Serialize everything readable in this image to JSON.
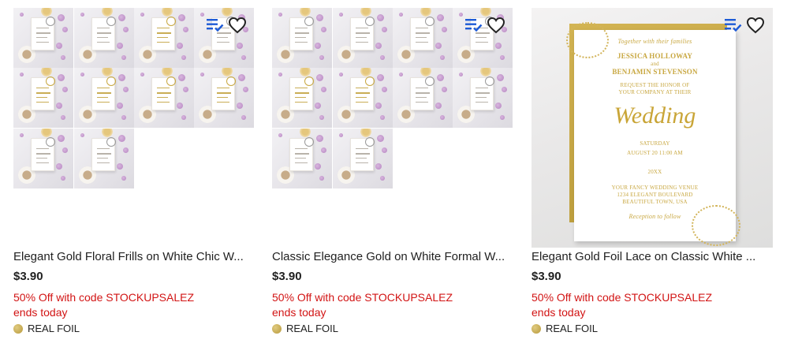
{
  "products": [
    {
      "title": "Elegant Gold Floral Frills on White Chic W...",
      "price": "$3.90",
      "promo_line1": "50% Off with code STOCKUPSALEZ",
      "promo_line2": "ends today",
      "badge": "REAL FOIL",
      "thumbnail_count": 10,
      "icons": [
        "add-to-list-icon",
        "heart-icon"
      ]
    },
    {
      "title": "Classic Elegance Gold on White Formal W...",
      "price": "$3.90",
      "promo_line1": "50% Off with code STOCKUPSALEZ",
      "promo_line2": "ends today",
      "badge": "REAL FOIL",
      "thumbnail_count": 10,
      "icons": [
        "add-to-list-icon",
        "heart-icon"
      ]
    },
    {
      "title": "Elegant Gold Foil Lace on Classic White ...",
      "price": "$3.90",
      "promo_line1": "50% Off with code STOCKUPSALEZ",
      "promo_line2": "ends today",
      "badge": "REAL FOIL",
      "icons": [
        "add-to-list-icon",
        "heart-icon"
      ],
      "invitation": {
        "top_script": "Together with their families",
        "name1": "JESSICA HOLLOWAY",
        "and": "and",
        "name2": "BENJAMIN STEVENSON",
        "request1": "REQUEST THE HONOR OF",
        "request2": "YOUR COMPANY AT THEIR",
        "script": "Wedding",
        "weekday": "SATURDAY",
        "date_line": "AUGUST  20  11:00 AM",
        "day": "20",
        "year": "20XX",
        "venue1": "YOUR FANCY WEDDING VENUE",
        "venue2": "1234 ELEGANT BOULEVARD",
        "venue3": "BEAUTIFUL TOWN, USA",
        "reception": "Reception to follow"
      }
    }
  ],
  "colors": {
    "promo_red": "#d21414",
    "list_icon_blue": "#1e5bd6",
    "gold": "#c8a740"
  }
}
